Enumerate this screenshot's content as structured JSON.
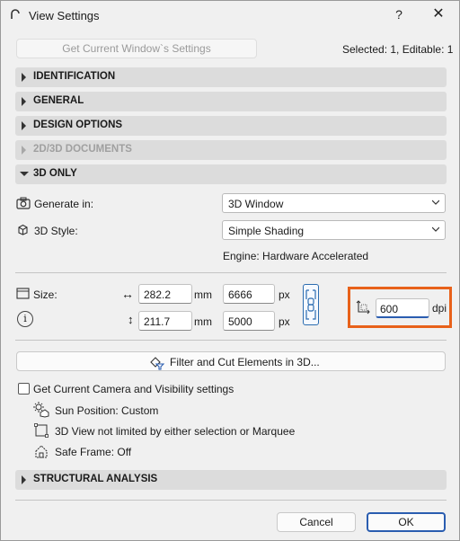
{
  "window": {
    "title": "View Settings",
    "help_label": "?",
    "close_label": "✕"
  },
  "header": {
    "get_settings_label": "Get Current Window`s Settings",
    "selection_info": "Selected: 1, Editable: 1"
  },
  "sections": {
    "identification": "IDENTIFICATION",
    "general": "GENERAL",
    "design_options": "DESIGN OPTIONS",
    "documents": "2D/3D DOCUMENTS",
    "only3d": "3D ONLY",
    "structural": "STRUCTURAL ANALYSIS"
  },
  "only3d": {
    "generate_label": "Generate in:",
    "generate_value": "3D Window",
    "style_label": "3D Style:",
    "style_value": "Simple Shading",
    "engine_text": "Engine: Hardware Accelerated"
  },
  "size": {
    "label": "Size:",
    "width_mm": "282.2",
    "height_mm": "211.7",
    "mm_unit": "mm",
    "width_px": "6666",
    "height_px": "5000",
    "px_unit": "px",
    "width_symbol": "↔",
    "height_symbol": "↕",
    "dpi_value": "600",
    "dpi_unit": "dpi",
    "info_symbol": "i"
  },
  "filter": {
    "button_label": "Filter and Cut Elements in 3D..."
  },
  "camera": {
    "checkbox_label": "Get Current Camera and Visibility settings",
    "checked": false,
    "sun_position": "Sun Position: Custom",
    "view_limit": "3D View not limited by either selection or Marquee",
    "safe_frame": "Safe Frame: Off"
  },
  "footer": {
    "cancel_label": "Cancel",
    "ok_label": "OK"
  },
  "colors": {
    "accent": "#2a5db0",
    "highlight_box": "#e8611a",
    "section_bg": "#dcdcdc"
  }
}
